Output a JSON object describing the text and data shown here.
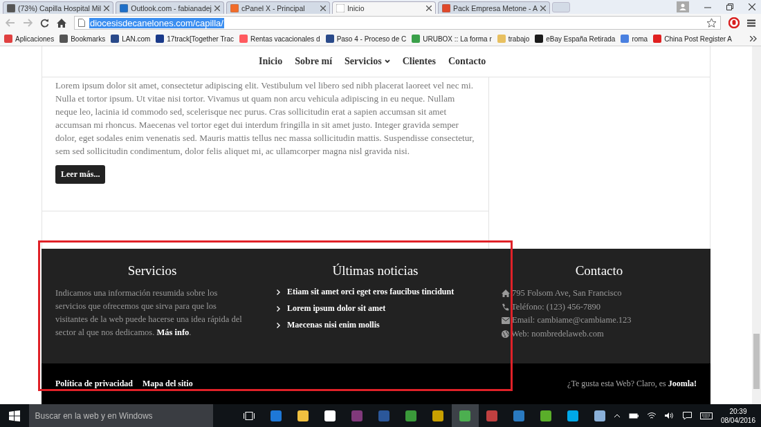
{
  "browser": {
    "tabs": [
      {
        "title": "(73%) Capilla Hospital Mil",
        "selected": false,
        "color": "#555555"
      },
      {
        "title": "Outlook.com - fabianadej",
        "selected": false,
        "color": "#1e6fc8"
      },
      {
        "title": "cPanel X - Principal",
        "selected": false,
        "color": "#f26c2a"
      },
      {
        "title": "Inicio",
        "selected": true,
        "color": "#ffffff"
      },
      {
        "title": "Pack Empresa Metone - A",
        "selected": false,
        "color": "#e0482a"
      }
    ],
    "address": "diocesisdecanelones.com/capilla/",
    "bookmarks": [
      {
        "label": "Aplicaciones",
        "color": "#e04040"
      },
      {
        "label": "Bookmarks",
        "color": "#555555"
      },
      {
        "label": "LAN.com",
        "color": "#2a4a8a"
      },
      {
        "label": "17track[Together Trac",
        "color": "#1a3a8a"
      },
      {
        "label": "Rentas vacacionales d",
        "color": "#ff5a5f"
      },
      {
        "label": "Paso 4 - Proceso de C",
        "color": "#2a4a8a"
      },
      {
        "label": "URUBOX :: La forma r",
        "color": "#3aa04a"
      },
      {
        "label": "trabajo",
        "color": "#e8c060"
      },
      {
        "label": "eBay España Retirada",
        "color": "#1a1a1a"
      },
      {
        "label": "roma",
        "color": "#4a80e0"
      },
      {
        "label": "China Post Register A",
        "color": "#e02020"
      }
    ]
  },
  "nav": [
    {
      "label": "Inicio",
      "has_menu": false
    },
    {
      "label": "Sobre mí",
      "has_menu": false
    },
    {
      "label": "Servicios",
      "has_menu": true
    },
    {
      "label": "Clientes",
      "has_menu": false
    },
    {
      "label": "Contacto",
      "has_menu": false
    }
  ],
  "article": {
    "text": "Lorem ipsum dolor sit amet, consectetur adipiscing elit. Vestibulum vel libero sed nibh placerat laoreet vel nec mi. Nulla et tortor ipsum. Ut vitae nisi tortor. Vivamus ut quam non arcu vehicula adipiscing in eu neque. Nullam neque leo, lacinia id commodo sed, scelerisque nec purus. Cras sollicitudin erat a sapien accumsan sit amet accumsan mi rhoncus. Maecenas vel tortor eget dui interdum fringilla in sit amet justo. Integer gravida semper dolor, eget sodales enim venenatis sed. Mauris mattis tellus nec massa sollicitudin mattis. Suspendisse consectetur, sem sed sollicitudin condimentum, dolor felis aliquet mi, ac ullamcorper magna nisl gravida nisi.",
    "button": "Leer más..."
  },
  "footer": {
    "services": {
      "title": "Servicios",
      "text": "Indicamos una información resumida sobre los servicios que ofrecemos que sirva para que los visitantes de la web puede hacerse una idea rápida del sector al que nos dedicamos. **Más info**."
    },
    "news": {
      "title": "Últimas noticias",
      "items": [
        "Etiam sit amet orci eget eros faucibus tincidunt",
        "Lorem ipsum dolor sit amet",
        "Maecenas nisi enim mollis"
      ]
    },
    "contact": {
      "title": "Contacto",
      "items": [
        {
          "kind": "home",
          "text": "795 Folsom Ave, San Francisco"
        },
        {
          "kind": "phone",
          "text": "Teléfono: (123) 456-7890"
        },
        {
          "kind": "mail",
          "text": "Email: cambiame@cambiame.123"
        },
        {
          "kind": "web",
          "text": "Web: nombredelaweb.com"
        }
      ]
    },
    "links": [
      "Política de privacidad",
      "Mapa del sitio"
    ],
    "credit": "¿Te gusta esta Web? Claro, es **Joomla!**"
  },
  "highlight_frame": {
    "shown": true
  },
  "taskbar": {
    "search_placeholder": "Buscar en la web y en Windows",
    "apps": [
      {
        "color": "#1e78d7",
        "selected": false
      },
      {
        "color": "#f0c040",
        "selected": false
      },
      {
        "color": "#ffffff",
        "selected": false
      },
      {
        "color": "#80397b",
        "selected": false
      },
      {
        "color": "#2b579a",
        "selected": false
      },
      {
        "color": "#3a9a3a",
        "selected": false
      },
      {
        "color": "#c8a000",
        "selected": false
      },
      {
        "color": "#4caf50",
        "selected": true
      },
      {
        "color": "#c04040",
        "selected": false
      },
      {
        "color": "#2a7ac0",
        "selected": false
      },
      {
        "color": "#5aae2a",
        "selected": false
      },
      {
        "color": "#00a8e8",
        "selected": false
      },
      {
        "color": "#8ab0d8",
        "selected": false
      }
    ],
    "time": "20:39",
    "date": "08/04/2016"
  }
}
